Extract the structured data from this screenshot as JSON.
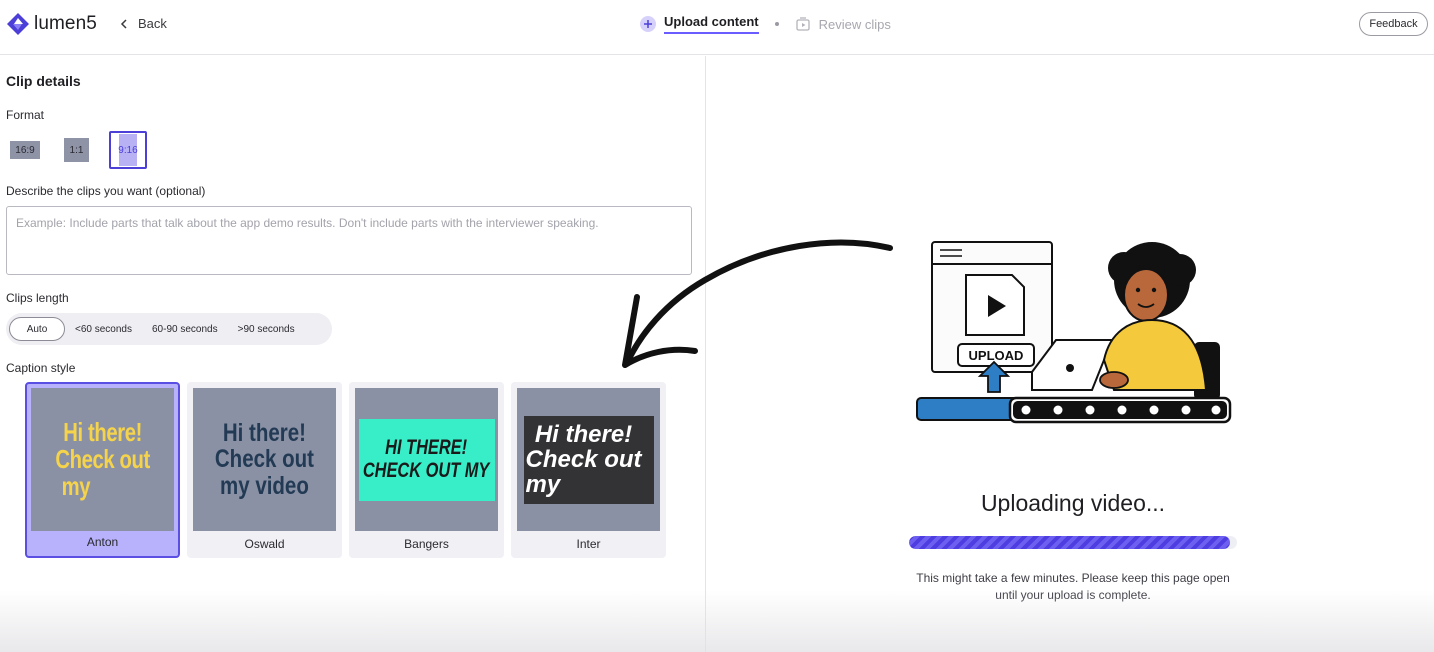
{
  "header": {
    "logo_text": "lumen5",
    "back_label": "Back",
    "steps": [
      {
        "label": "Upload content",
        "state": "active",
        "icon": "plus-circle-icon"
      },
      {
        "label": "Review clips",
        "state": "inactive",
        "icon": "clip-box-icon"
      }
    ],
    "feedback_label": "Feedback"
  },
  "clip_details": {
    "title": "Clip details",
    "format_label": "Format",
    "formats": [
      {
        "label": "16:9",
        "selected": false
      },
      {
        "label": "1:1",
        "selected": false
      },
      {
        "label": "9:16",
        "selected": true
      }
    ],
    "describe_label": "Describe the clips you want (optional)",
    "describe_placeholder": "Example: Include parts that talk about the app demo results. Don't include parts with the interviewer speaking.",
    "length_label": "Clips length",
    "lengths": [
      {
        "label": "Auto",
        "selected": true
      },
      {
        "label": "<60 seconds",
        "selected": false
      },
      {
        "label": "60-90 seconds",
        "selected": false
      },
      {
        "label": ">90 seconds",
        "selected": false
      }
    ],
    "caption_label": "Caption style",
    "caption_styles": [
      {
        "name": "Anton",
        "preview_lines": [
          "Hi there!",
          "Check out",
          "my"
        ],
        "selected": true
      },
      {
        "name": "Oswald",
        "preview_lines": [
          "Hi there!",
          "Check out",
          "my video"
        ],
        "selected": false
      },
      {
        "name": "Bangers",
        "preview_lines": [
          "HI THERE!",
          "CHECK OUT MY"
        ],
        "selected": false
      },
      {
        "name": "Inter",
        "preview_lines": [
          "Hi there!",
          "Check out",
          "my"
        ],
        "selected": false
      }
    ]
  },
  "upload": {
    "illustration_label": "UPLOAD",
    "status": "Uploading video...",
    "progress_fraction": 0.98,
    "note_line1": "This might take a few minutes. Please keep this page open",
    "note_line2": "until your upload is complete."
  },
  "colors": {
    "accent": "#5a4ee3",
    "accent_light": "#b8b1fb",
    "preview_bg": "#8a91a4",
    "anton_text": "#f5d34b",
    "bangers_bg": "#38eec9"
  }
}
